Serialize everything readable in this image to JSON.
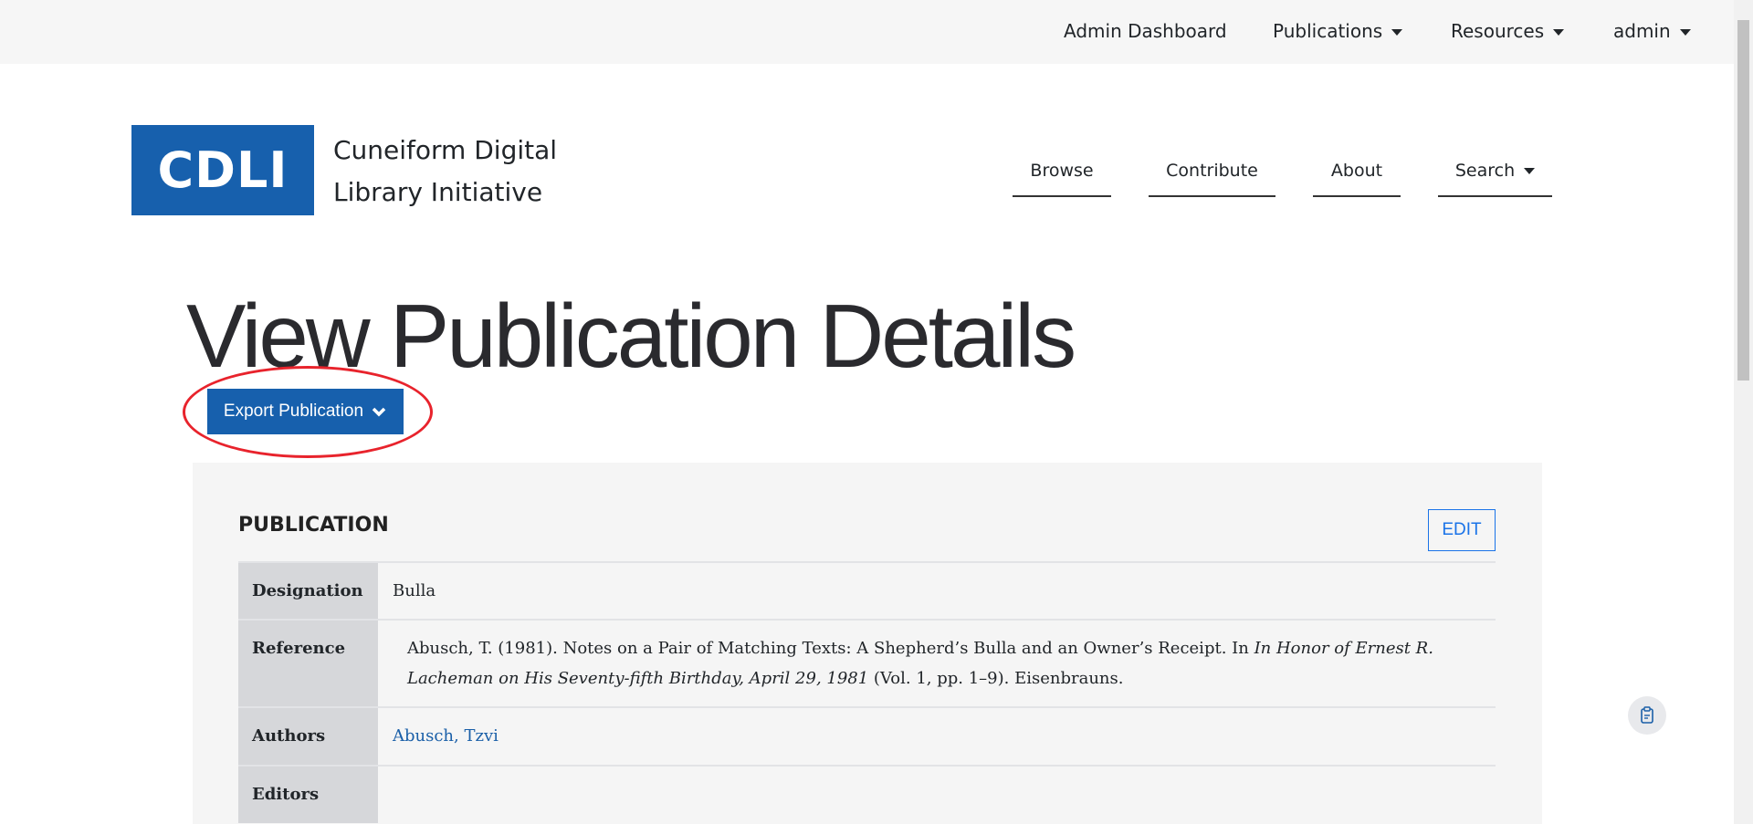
{
  "topbar": {
    "items": [
      {
        "label": "Admin Dashboard",
        "dropdown": false
      },
      {
        "label": "Publications",
        "dropdown": true
      },
      {
        "label": "Resources",
        "dropdown": true
      },
      {
        "label": "admin",
        "dropdown": true
      }
    ]
  },
  "brand": {
    "logo": "CDLI",
    "line1": "Cuneiform Digital",
    "line2": "Library Initiative",
    "color": "#1760ad"
  },
  "nav": {
    "items": [
      "Browse",
      "Contribute",
      "About",
      "Search"
    ]
  },
  "page": {
    "title": "View Publication Details",
    "export_label": "Export Publication",
    "highlight_color": "#e8232c"
  },
  "publication": {
    "heading": "PUBLICATION",
    "edit_label": "EDIT",
    "rows": [
      {
        "label": "Designation",
        "value": "Bulla"
      },
      {
        "label": "Reference",
        "value_a": "Abusch, T. (1981). Notes on a Pair of Matching Texts: A Shepherd’s Bulla and an Owner’s Receipt. In ",
        "value_italic": "In Honor of Ernest R. Lacheman on His Seventy-fifth Birthday, April 29, 1981",
        "value_b": " (Vol. 1, pp. 1–9). Eisenbrauns."
      },
      {
        "label": "Authors",
        "value": "Abusch, Tzvi"
      },
      {
        "label": "Editors",
        "value": ""
      }
    ]
  },
  "icons": {
    "fab": "clipboard-icon",
    "export": "chevron-down-icon"
  }
}
